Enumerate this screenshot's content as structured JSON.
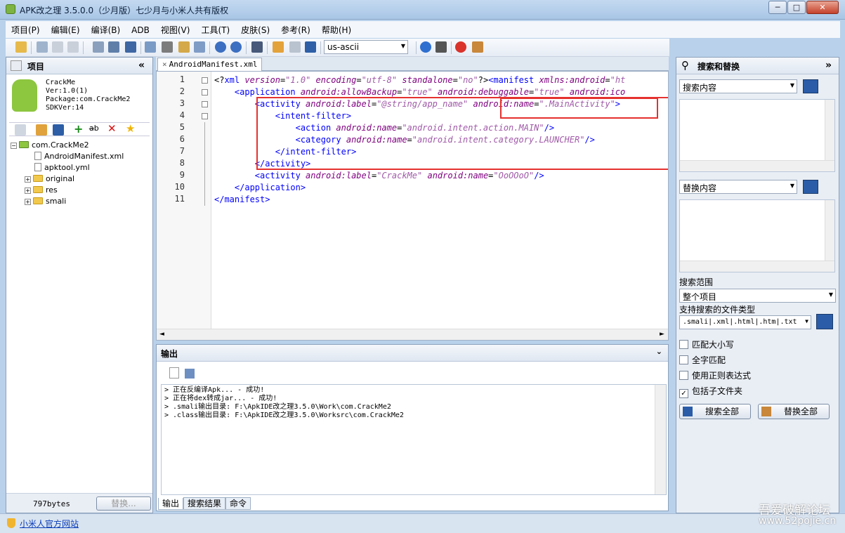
{
  "window": {
    "title": "APK改之理 3.5.0.0（少月版）七少月与小米人共有版权",
    "btn_min": "─",
    "btn_max": "□",
    "btn_close": "✕"
  },
  "menu": [
    "项目(P)",
    "编辑(E)",
    "编译(B)",
    "ADB",
    "视图(V)",
    "工具(T)",
    "皮肤(S)",
    "参考(R)",
    "帮助(H)"
  ],
  "toolbar": {
    "encoding": "us-ascii"
  },
  "project_panel": {
    "title": "项目",
    "collapse": "«",
    "app_info": [
      "CrackMe",
      "Ver:1.0(1)",
      "Package:com.CrackMe2",
      "SDKVer:14"
    ],
    "tree": {
      "root": "com.CrackMe2",
      "files": [
        "AndroidManifest.xml",
        "apktool.yml"
      ],
      "folders": [
        "original",
        "res",
        "smali"
      ]
    },
    "size": "797bytes",
    "replace_button": "替换..."
  },
  "editor": {
    "tab": "AndroidManifest.xml",
    "line_numbers": [
      "1",
      "2",
      "3",
      "4",
      "5",
      "6",
      "7",
      "8",
      "9",
      "10",
      "11"
    ],
    "lines": [
      [
        [
          "pun",
          "<?"
        ],
        [
          "tag",
          "xml "
        ],
        [
          "attr",
          "version"
        ],
        [
          "pun",
          "="
        ],
        [
          "val",
          "\"1.0\""
        ],
        [
          "pun",
          " "
        ],
        [
          "attr",
          "encoding"
        ],
        [
          "pun",
          "="
        ],
        [
          "val",
          "\"utf-8\""
        ],
        [
          "pun",
          " "
        ],
        [
          "attr",
          "standalone"
        ],
        [
          "pun",
          "="
        ],
        [
          "val",
          "\"no\""
        ],
        [
          "pun",
          "?>"
        ],
        [
          "tag",
          "<manifest "
        ],
        [
          "attr",
          "xmlns:android"
        ],
        [
          "pun",
          "="
        ],
        [
          "val",
          "\"ht"
        ]
      ],
      [
        [
          "pun",
          "    "
        ],
        [
          "tag",
          "<application "
        ],
        [
          "attr",
          "android:allowBackup"
        ],
        [
          "pun",
          "="
        ],
        [
          "val",
          "\"true\""
        ],
        [
          "pun",
          " "
        ],
        [
          "attr",
          "android:debuggable"
        ],
        [
          "pun",
          "="
        ],
        [
          "val",
          "\"true\""
        ],
        [
          "pun",
          " "
        ],
        [
          "attr",
          "android:ico"
        ]
      ],
      [
        [
          "pun",
          "        "
        ],
        [
          "tag",
          "<activity "
        ],
        [
          "attr",
          "android:label"
        ],
        [
          "pun",
          "="
        ],
        [
          "val",
          "\"@string/app_name\""
        ],
        [
          "pun",
          " "
        ],
        [
          "attr",
          "android:name"
        ],
        [
          "pun",
          "="
        ],
        [
          "val",
          "\".MainActivity\""
        ],
        [
          "tag",
          ">"
        ]
      ],
      [
        [
          "pun",
          "            "
        ],
        [
          "tag",
          "<intent-filter>"
        ]
      ],
      [
        [
          "pun",
          "                "
        ],
        [
          "tag",
          "<action "
        ],
        [
          "attr",
          "android:name"
        ],
        [
          "pun",
          "="
        ],
        [
          "val",
          "\"android.intent.action.MAIN\""
        ],
        [
          "tag",
          "/>"
        ]
      ],
      [
        [
          "pun",
          "                "
        ],
        [
          "tag",
          "<category "
        ],
        [
          "attr",
          "android:name"
        ],
        [
          "pun",
          "="
        ],
        [
          "val",
          "\"android.intent.category.LAUNCHER\""
        ],
        [
          "tag",
          "/>"
        ]
      ],
      [
        [
          "pun",
          "            "
        ],
        [
          "tag",
          "</intent-filter>"
        ]
      ],
      [
        [
          "pun",
          "        "
        ],
        [
          "tag",
          "</activity>"
        ]
      ],
      [
        [
          "pun",
          "        "
        ],
        [
          "tag",
          "<activity "
        ],
        [
          "attr",
          "android:label"
        ],
        [
          "pun",
          "="
        ],
        [
          "val",
          "\"CrackMe\""
        ],
        [
          "pun",
          " "
        ],
        [
          "attr",
          "android:name"
        ],
        [
          "pun",
          "="
        ],
        [
          "val",
          "\"OoOOoO\""
        ],
        [
          "tag",
          "/>"
        ]
      ],
      [
        [
          "pun",
          "    "
        ],
        [
          "tag",
          "</application>"
        ]
      ],
      [
        [
          "tag",
          "</manifest>"
        ]
      ]
    ]
  },
  "output": {
    "title": "输出",
    "lines": [
      "> 正在反编译Apk...  - 成功!",
      "> 正在将dex转成jar...  - 成功!",
      "> .smali输出目录: F:\\ApkIDE改之理3.5.0\\Work\\com.CrackMe2",
      "> .class输出目录: F:\\ApkIDE改之理3.5.0\\Worksrc\\com.CrackMe2"
    ],
    "tabs": [
      "输出",
      "搜索结果",
      "命令"
    ]
  },
  "search_panel": {
    "title": "搜索和替换",
    "search_placeholder": "搜索内容",
    "replace_placeholder": "替换内容",
    "scope_label": "搜索范围",
    "scope_value": "整个项目",
    "filetype_label": "支持搜索的文件类型",
    "filetype_value": ".smali|.xml|.html|.htm|.txt",
    "options": [
      {
        "label": "匹配大小写",
        "checked": false
      },
      {
        "label": "全字匹配",
        "checked": false
      },
      {
        "label": "使用正则表达式",
        "checked": false
      },
      {
        "label": "包括子文件夹",
        "checked": true
      }
    ],
    "search_all": "搜索全部",
    "replace_all": "替换全部"
  },
  "statusbar": {
    "link": "小米人官方网站"
  },
  "watermark": {
    "line1": "吾爱破解论坛",
    "line2": "www.52pojie.cn"
  }
}
